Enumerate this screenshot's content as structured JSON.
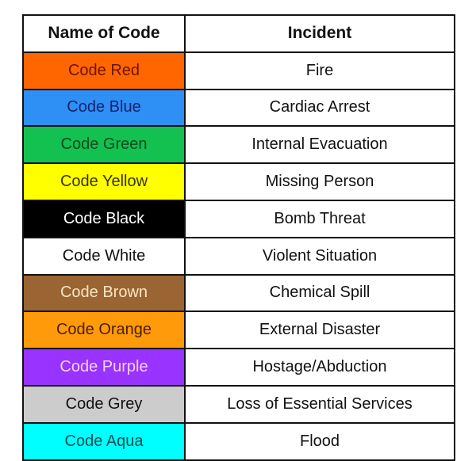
{
  "table": {
    "headers": {
      "name": "Name of Code",
      "incident": "Incident"
    },
    "rows": [
      {
        "code": "Code Red",
        "incident": "Fire",
        "bg": "#ff6600",
        "fg": "#6b1400"
      },
      {
        "code": "Code Blue",
        "incident": "Cardiac Arrest",
        "bg": "#2e8ff5",
        "fg": "#15236b"
      },
      {
        "code": "Code Green",
        "incident": "Internal Evacuation",
        "bg": "#12c150",
        "fg": "#0b4a1c"
      },
      {
        "code": "Code Yellow",
        "incident": "Missing Person",
        "bg": "#ffff00",
        "fg": "#3a3300"
      },
      {
        "code": "Code Black",
        "incident": "Bomb Threat",
        "bg": "#000000",
        "fg": "#ffffff"
      },
      {
        "code": "Code White",
        "incident": "Violent Situation",
        "bg": "#ffffff",
        "fg": "#111111"
      },
      {
        "code": "Code Brown",
        "incident": "Chemical Spill",
        "bg": "#9a6433",
        "fg": "#f7e6c4"
      },
      {
        "code": "Code Orange",
        "incident": "External Disaster",
        "bg": "#ff9a0a",
        "fg": "#4a1f00"
      },
      {
        "code": "Code Purple",
        "incident": "Hostage/Abduction",
        "bg": "#9933ff",
        "fg": "#f5d2f2"
      },
      {
        "code": "Code Grey",
        "incident": "Loss of Essential Services",
        "bg": "#cccccc",
        "fg": "#111111"
      },
      {
        "code": "Code Aqua",
        "incident": "Flood",
        "bg": "#00ffff",
        "fg": "#0b5050"
      }
    ]
  }
}
